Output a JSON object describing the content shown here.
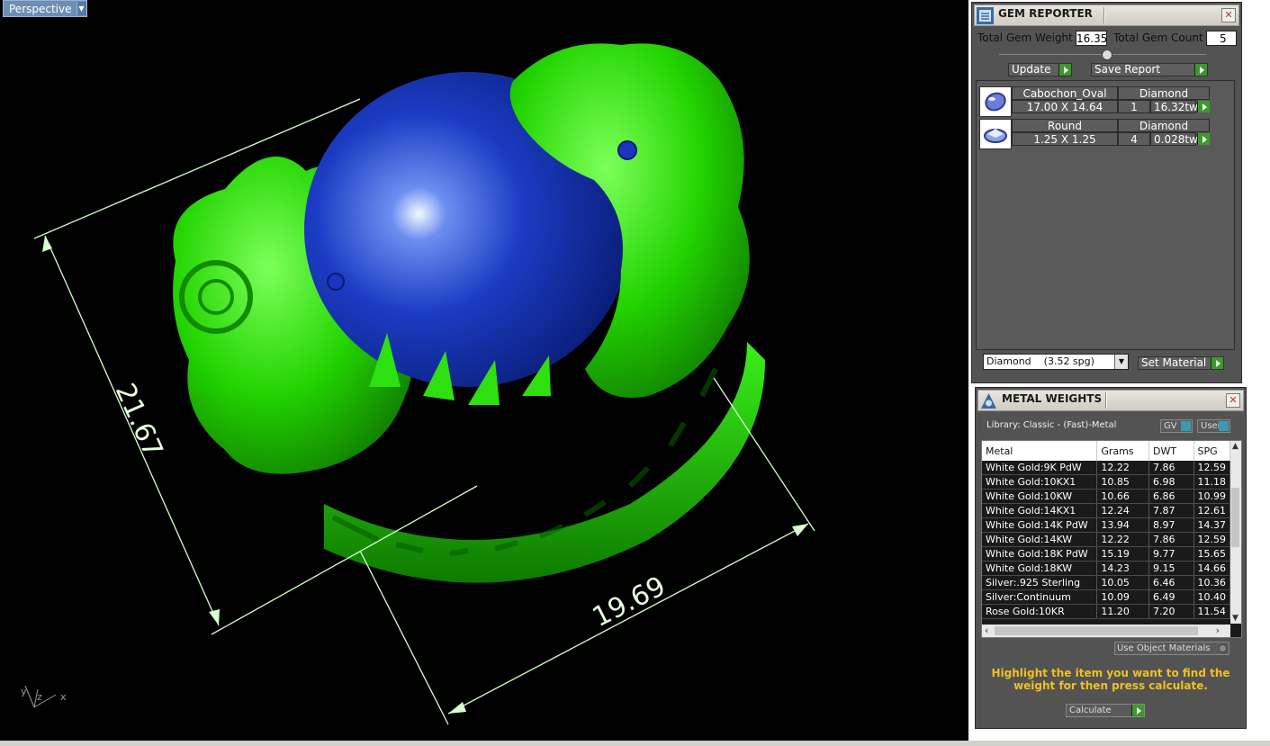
{
  "viewport": {
    "tab_label": "Perspective",
    "dimensions": [
      "21.67",
      "19.69"
    ],
    "axis_labels": {
      "y": "y",
      "z": "z",
      "x": "x"
    }
  },
  "gem_reporter": {
    "title": "GEM REPORTER",
    "total_weight_label": "Total Gem Weight",
    "total_weight_value": "16.35",
    "total_count_label": "Total Gem Count",
    "total_count_value": "5",
    "update_label": "Update",
    "save_report_label": "Save Report",
    "gems": [
      {
        "shape": "Cabochon_Oval",
        "material": "Diamond",
        "size": "17.00 X 14.64",
        "count": "1",
        "weight": "16.32tw"
      },
      {
        "shape": "Round",
        "material": "Diamond",
        "size": "1.25 X 1.25",
        "count": "4",
        "weight": "0.028tw"
      }
    ],
    "material_select": "Diamond    (3.52 spg)",
    "set_material_label": "Set Material"
  },
  "metal_weights": {
    "title": "METAL WEIGHTS",
    "library_label": "Library: Classic - (Fast)-Metal",
    "gv_label": "GV",
    "user_label": "User",
    "columns": [
      "Metal",
      "Grams",
      "DWT",
      "SPG"
    ],
    "rows": [
      [
        "White Gold:9K PdW",
        "12.22",
        "7.86",
        "12.59"
      ],
      [
        "White Gold:10KX1",
        "10.85",
        "6.98",
        "11.18"
      ],
      [
        "White Gold:10KW",
        "10.66",
        "6.86",
        "10.99"
      ],
      [
        "White Gold:14KX1",
        "12.24",
        "7.87",
        "12.61"
      ],
      [
        "White Gold:14K PdW",
        "13.94",
        "8.97",
        "14.37"
      ],
      [
        "White Gold:14KW",
        "12.22",
        "7.86",
        "12.59"
      ],
      [
        "White Gold:18K PdW",
        "15.19",
        "9.77",
        "15.65"
      ],
      [
        "White Gold:18KW",
        "14.23",
        "9.15",
        "14.66"
      ],
      [
        "Silver:.925 Sterling",
        "10.05",
        "6.46",
        "10.36"
      ],
      [
        "Silver:Continuum",
        "10.09",
        "6.49",
        "10.40"
      ],
      [
        "Rose Gold:10KR",
        "11.20",
        "7.20",
        "11.54"
      ]
    ],
    "use_object_materials_label": "Use Object Materials",
    "instruction": "Highlight the item you want to find the weight for then press calculate.",
    "calculate_label": "Calculate"
  },
  "colors": {
    "ring_green": "#22e000",
    "gem_blue": "#1030b0",
    "panel_gray": "#535353",
    "accent_green": "#3a9a2a",
    "instruction_yellow": "#f0c020"
  }
}
